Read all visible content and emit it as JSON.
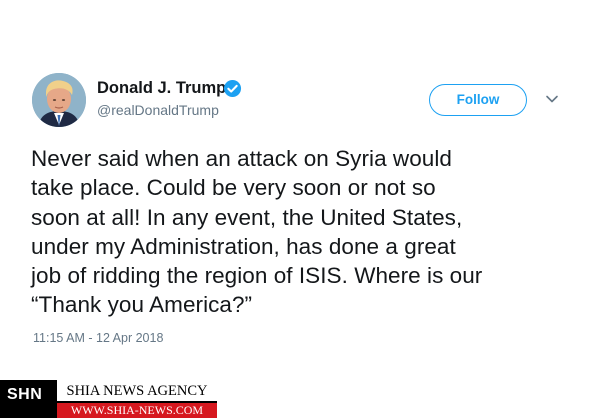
{
  "tweet": {
    "author": {
      "display_name": "Donald J. Trump",
      "handle": "@realDonaldTrump",
      "verified": true,
      "avatar_icon": "profile-photo"
    },
    "follow_label": "Follow",
    "menu_icon": "chevron-down-icon",
    "text_lines": [
      "Never said when an attack on Syria would",
      "take place. Could be very soon or not so",
      "soon at all! In any event, the United States,",
      "under my Administration, has done a great",
      "job of ridding the region of ISIS. Where is our",
      "“Thank you America?”"
    ],
    "timestamp": "11:15 AM - 12 Apr 2018"
  },
  "watermark": {
    "abbr": "SHN",
    "name": "SHIA NEWS AGENCY",
    "url": "WWW.SHIA-NEWS.COM"
  },
  "colors": {
    "accent": "#1da1f2",
    "text": "#14171a",
    "muted": "#657786",
    "watermark_red": "#d6181f",
    "watermark_black": "#000000"
  }
}
